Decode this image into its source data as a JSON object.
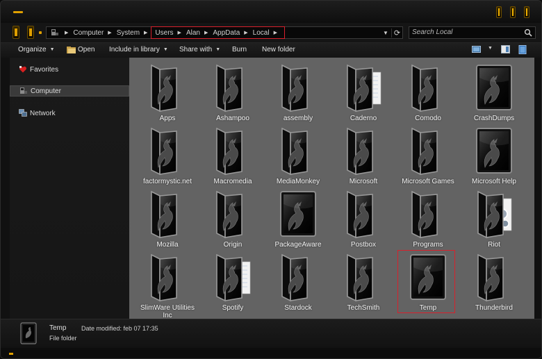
{
  "titlebar": {
    "caption_buttons": [
      "minimize-button",
      "maximize-button",
      "close-button"
    ]
  },
  "address": {
    "breadcrumbs": [
      "Computer",
      "System",
      "Users",
      "Alan",
      "AppData",
      "Local"
    ],
    "highlighted_from_index": 2
  },
  "search": {
    "placeholder": "Search Local"
  },
  "toolbar": {
    "organize": "Organize",
    "open": "Open",
    "include": "Include in library",
    "share": "Share with",
    "burn": "Burn",
    "new_folder": "New folder"
  },
  "sidebar": {
    "items": [
      {
        "label": "Favorites",
        "icon": "favorites-icon"
      },
      {
        "label": "Computer",
        "icon": "computer-icon"
      },
      {
        "label": "Network",
        "icon": "network-icon"
      }
    ],
    "selected": "Computer"
  },
  "folders": [
    {
      "name": "Apps",
      "style": "folder"
    },
    {
      "name": "Ashampoo",
      "style": "folder"
    },
    {
      "name": "assembly",
      "style": "folder"
    },
    {
      "name": "Caderno",
      "style": "folder-doc"
    },
    {
      "name": "Comodo",
      "style": "folder"
    },
    {
      "name": "CrashDumps",
      "style": "frame"
    },
    {
      "name": "factormystic.net",
      "style": "folder"
    },
    {
      "name": "Macromedia",
      "style": "folder"
    },
    {
      "name": "MediaMonkey",
      "style": "folder"
    },
    {
      "name": "Microsoft",
      "style": "folder"
    },
    {
      "name": "Microsoft Games",
      "style": "folder"
    },
    {
      "name": "Microsoft Help",
      "style": "frame"
    },
    {
      "name": "Mozilla",
      "style": "folder"
    },
    {
      "name": "Origin",
      "style": "folder"
    },
    {
      "name": "PackageAware",
      "style": "frame"
    },
    {
      "name": "Postbox",
      "style": "folder"
    },
    {
      "name": "Programs",
      "style": "folder"
    },
    {
      "name": "Riot",
      "style": "folder-gear"
    },
    {
      "name": "SlimWare Utilities Inc",
      "style": "folder"
    },
    {
      "name": "Spotify",
      "style": "folder-doc"
    },
    {
      "name": "Stardock",
      "style": "folder"
    },
    {
      "name": "TechSmith",
      "style": "folder"
    },
    {
      "name": "Temp",
      "style": "frame"
    },
    {
      "name": "Thunderbird",
      "style": "folder"
    }
  ],
  "selected_folder": "Temp",
  "details": {
    "name": "Temp",
    "date_modified": "Date modified: feb 07 17:35",
    "type": "File folder"
  },
  "colors": {
    "accent": "#e0a000",
    "highlight": "#d8202c",
    "content_bg": "#636363"
  }
}
